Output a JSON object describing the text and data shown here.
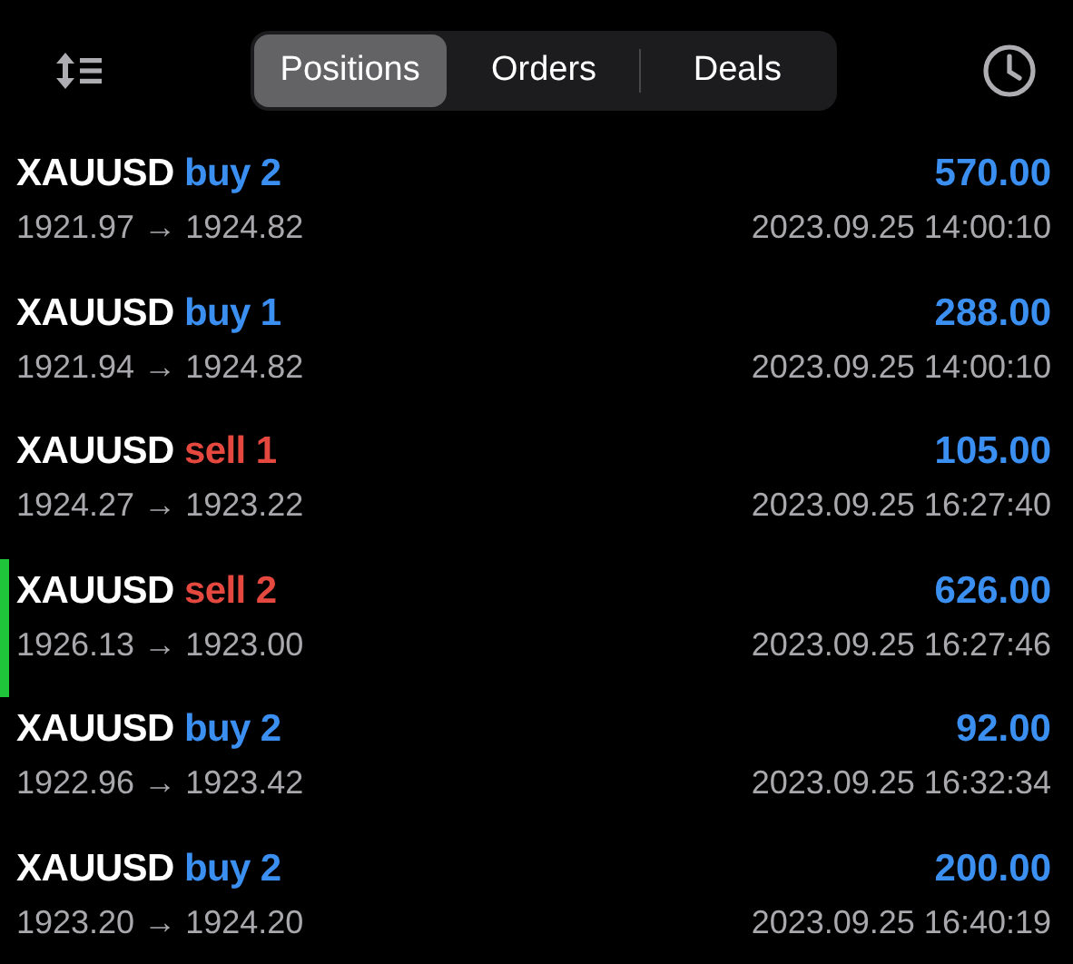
{
  "tabs": [
    {
      "label": "Positions",
      "selected": true
    },
    {
      "label": "Orders",
      "selected": false
    },
    {
      "label": "Deals",
      "selected": false
    }
  ],
  "positions": [
    {
      "symbol": "XAUUSD",
      "side": "buy",
      "volume": "2",
      "prices": "1921.97 → 1924.82",
      "profit": "570.00",
      "time": "2023.09.25 14:00:10",
      "selected": false
    },
    {
      "symbol": "XAUUSD",
      "side": "buy",
      "volume": "1",
      "prices": "1921.94 → 1924.82",
      "profit": "288.00",
      "time": "2023.09.25 14:00:10",
      "selected": false
    },
    {
      "symbol": "XAUUSD",
      "side": "sell",
      "volume": "1",
      "prices": "1924.27 → 1923.22",
      "profit": "105.00",
      "time": "2023.09.25 16:27:40",
      "selected": false
    },
    {
      "symbol": "XAUUSD",
      "side": "sell",
      "volume": "2",
      "prices": "1926.13 → 1923.00",
      "profit": "626.00",
      "time": "2023.09.25 16:27:46",
      "selected": true
    },
    {
      "symbol": "XAUUSD",
      "side": "buy",
      "volume": "2",
      "prices": "1922.96 → 1923.42",
      "profit": "92.00",
      "time": "2023.09.25 16:32:34",
      "selected": false
    },
    {
      "symbol": "XAUUSD",
      "side": "buy",
      "volume": "2",
      "prices": "1923.20 → 1924.20",
      "profit": "200.00",
      "time": "2023.09.25 16:40:19",
      "selected": false
    }
  ]
}
